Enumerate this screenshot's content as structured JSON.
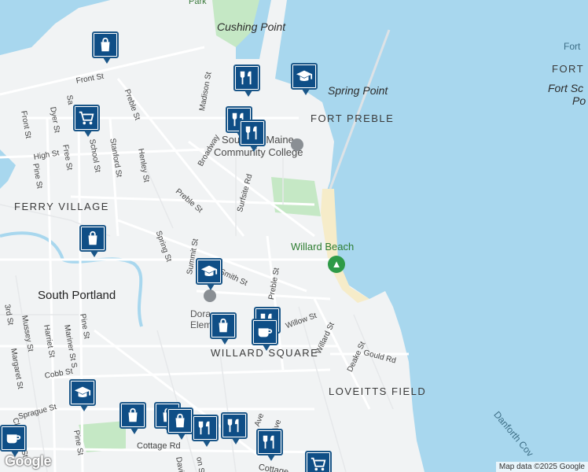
{
  "labels": {
    "cushing_point": "Cushing Point",
    "park": "Park",
    "spring_point": "Spring Point",
    "fort_preble": "FORT PREBLE",
    "college_1": "Southern Maine",
    "college_2": "Community College",
    "ferry_village": "FERRY VILLAGE",
    "willard_beach": "Willard Beach",
    "south_portland": "South Portland",
    "dora_1": "Dora",
    "dora_2": "Elem",
    "willard_square": "WILLARD SQUARE",
    "loveitts_field": "LOVEITTS FIELD",
    "fort_r1": "Fort",
    "fort_r2": "FORT",
    "fort_r3": "Fort Sc",
    "fort_r4": "Po",
    "danforth": "Danforth Cov"
  },
  "streets": {
    "front_st": "Front St",
    "madison_st": "Madison St",
    "preble_st_n": "Preble St",
    "dyer_st": "Dyer St",
    "free_st": "Free St",
    "school_st": "School St",
    "stanford_st": "Stanford St",
    "henley_st": "Henley St",
    "high_st": "High St",
    "pine_st": "Pine St",
    "front_st_w": "Front St",
    "broadway": "Broadway",
    "preble_st_m": "Preble St",
    "surfsite_rd": "Surfsite Rd",
    "spring_st": "Spring St",
    "summit_st": "Summit St",
    "smith_st": "Smith St",
    "preble_st_s": "Preble St",
    "willow_st": "Willow St",
    "willard_st": "Willard St",
    "deake_st": "Deake St",
    "gould_rd": "Gould Rd",
    "third_st": "3rd St",
    "mussey_st": "Mussey St",
    "harriet_st": "Harriet St",
    "mariner_st": "Mariner St S",
    "pine_st_s": "Pine St",
    "margaret_st": "Margaret St",
    "cobb_st": "Cobb St",
    "sprague_st": "Sprague St",
    "clemons_st": "Clemons St",
    "pine_st_b": "Pine St",
    "cottage_rd": "Cottage Rd",
    "cottage_rd2": "Cottage",
    "ave_1": "Ave",
    "ave_2": "Ave",
    "davis_st": "Davis St",
    "on_st": "on St",
    "sa_st": "Sa"
  },
  "pins": [
    {
      "id": "shop-1",
      "icon": "shopping-bag-icon"
    },
    {
      "id": "restaurant-1",
      "icon": "restaurant-icon"
    },
    {
      "id": "school-1",
      "icon": "school-icon"
    },
    {
      "id": "grocery-1",
      "icon": "grocery-cart-icon"
    },
    {
      "id": "restaurant-2",
      "icon": "restaurant-icon"
    },
    {
      "id": "restaurant-3",
      "icon": "restaurant-icon"
    },
    {
      "id": "shop-2",
      "icon": "shopping-bag-icon"
    },
    {
      "id": "school-2",
      "icon": "school-icon"
    },
    {
      "id": "restaurant-4",
      "icon": "restaurant-icon"
    },
    {
      "id": "shop-3",
      "icon": "shopping-bag-icon"
    },
    {
      "id": "cafe-1",
      "icon": "coffee-cup-icon"
    },
    {
      "id": "school-3",
      "icon": "school-icon"
    },
    {
      "id": "shop-4",
      "icon": "shopping-bag-icon"
    },
    {
      "id": "shop-5",
      "icon": "shopping-bag-icon"
    },
    {
      "id": "shop-6",
      "icon": "shopping-bag-icon"
    },
    {
      "id": "restaurant-5",
      "icon": "restaurant-icon"
    },
    {
      "id": "restaurant-6",
      "icon": "restaurant-icon"
    },
    {
      "id": "restaurant-7",
      "icon": "restaurant-icon"
    },
    {
      "id": "cafe-2",
      "icon": "coffee-cup-icon"
    },
    {
      "id": "grocery-2",
      "icon": "grocery-cart-icon"
    }
  ],
  "attribution": "Map data ©2025 Google",
  "logo": "Google",
  "colors": {
    "water": "#a8d7ee",
    "land": "#f1f3f4",
    "park": "#c5e8c5",
    "pin": "#0f4e86",
    "beach": "#f6ecc9"
  }
}
